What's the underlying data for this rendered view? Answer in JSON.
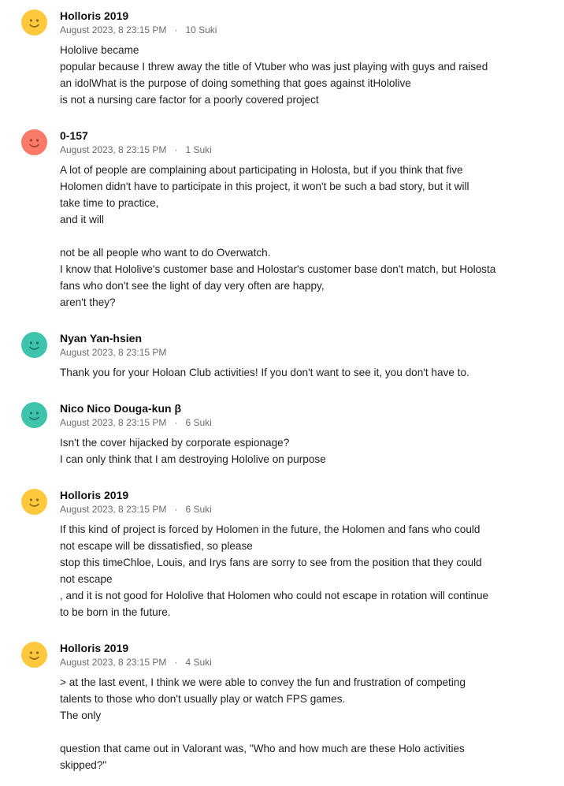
{
  "colors": {
    "avatar_yellow": "#ffc83d",
    "avatar_red": "#f97a68",
    "avatar_teal": "#3fc4ac",
    "face_dark": "#6b4a0c",
    "face_red_dark": "#8a2b1e",
    "face_teal_dark": "#0f5f50",
    "meta_gray": "#6b6b6b"
  },
  "comments": [
    {
      "author": "Holloris 2019",
      "timestamp": "August 2023, 8 23:15 PM",
      "separator": "·",
      "likes": "10 Suki",
      "avatar_icon": "smiley-face-icon",
      "avatar_color": "yellow",
      "lines": [
        "Hololive became",
        "popular because I threw away the title of Vtuber who was just playing with guys and raised",
        "an idolWhat is the purpose of doing something that goes against itHololive",
        "is not a nursing care factor for a poorly covered project"
      ]
    },
    {
      "author": "0-157",
      "timestamp": "August 2023, 8 23:15 PM",
      "separator": "·",
      "likes": "1 Suki",
      "avatar_icon": "smiley-face-icon",
      "avatar_color": "red",
      "lines": [
        "A lot of people are complaining about participating in Holosta, but if you think that five",
        "Holomen didn't have to participate in this project, it won't be such a bad story, but it will",
        "take time to practice,",
        "and it will",
        "",
        "not be all people who want to do Overwatch.",
        "I know that Hololive's customer base and Holostar's customer base don't match, but Holosta",
        "fans who don't see the light of day very often are happy,",
        "aren't they?"
      ]
    },
    {
      "author": "Nyan Yan-hsien",
      "timestamp": "August 2023, 8 23:15 PM",
      "separator": "",
      "likes": "",
      "avatar_icon": "smiley-face-icon",
      "avatar_color": "teal",
      "lines": [
        "Thank you for your Holoan Club activities! If you don't want to see it, you don't have to."
      ]
    },
    {
      "author": "Nico Nico Douga-kun β",
      "timestamp": "August 2023, 8 23:15 PM",
      "separator": "·",
      "likes": "6 Suki",
      "avatar_icon": "smiley-face-icon",
      "avatar_color": "teal",
      "lines": [
        "Isn't the cover hijacked by corporate espionage?",
        "I can only think that I am destroying Hololive on purpose"
      ]
    },
    {
      "author": "Holloris 2019",
      "timestamp": "August 2023, 8 23:15 PM",
      "separator": "·",
      "likes": "6 Suki",
      "avatar_icon": "smiley-face-icon",
      "avatar_color": "yellow",
      "lines": [
        "If this kind of project is forced by Holomen in the future, the Holomen and fans who could",
        "not escape will be dissatisfied, so please",
        "stop this timeChloe, Louis, and Irys fans are sorry to see from the position that they could",
        "not escape",
        ", and it is not good for Hololive that Holomen who could not escape in rotation will continue",
        "to be born in the future."
      ]
    },
    {
      "author": "Holloris 2019",
      "timestamp": "August 2023, 8 23:15 PM",
      "separator": "·",
      "likes": "4 Suki",
      "avatar_icon": "smiley-face-icon",
      "avatar_color": "yellow",
      "lines": [
        "> at the last event, I think we were able to convey the fun and frustration of competing",
        "talents to those who don't usually play or watch FPS games.",
        "The only",
        "",
        "question that came out in Valorant was, \"Who and how much are these Holo activities",
        "skipped?\""
      ]
    }
  ]
}
